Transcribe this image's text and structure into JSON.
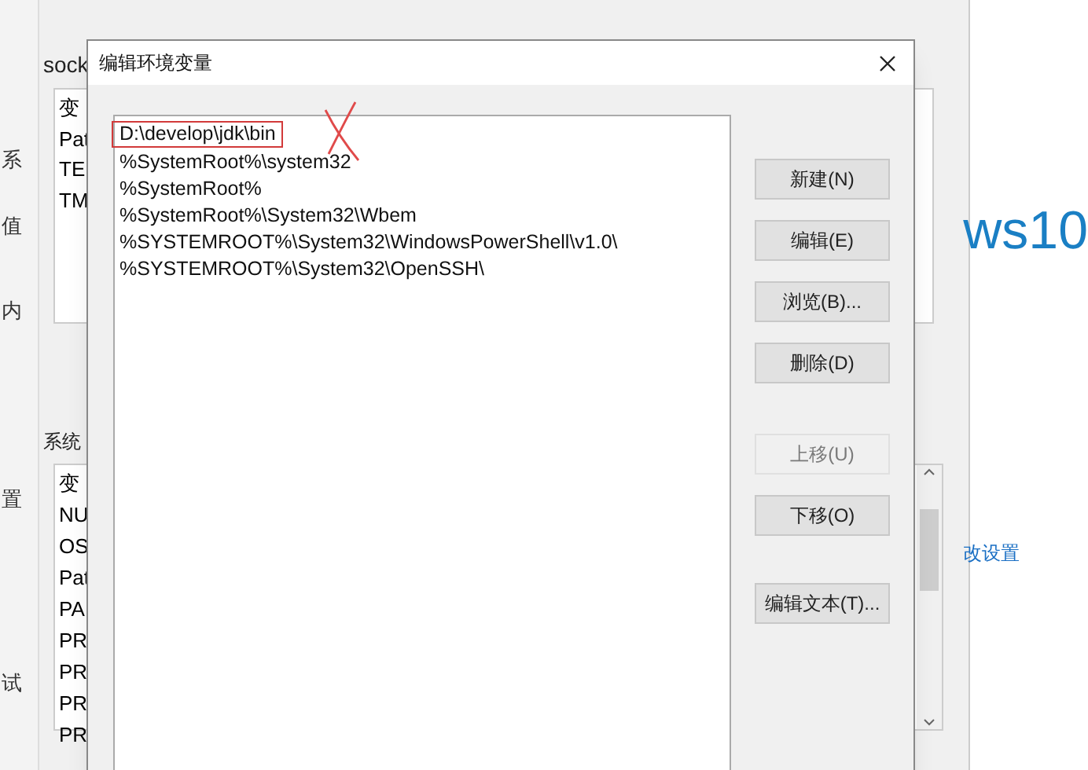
{
  "side_fragments": [
    "系",
    "值",
    "内",
    "置",
    "试"
  ],
  "background_window": {
    "user_label": "sock",
    "user_vars": {
      "column": "变",
      "rows": [
        "Pat",
        "TE",
        "TM"
      ]
    },
    "system_label": "系统",
    "system_vars": {
      "column": "变",
      "rows": [
        "NU",
        "OS",
        "Pat",
        "PA",
        "PR",
        "PR",
        "PR",
        "PR"
      ]
    }
  },
  "web_page": {
    "heading_fragment": "ws10",
    "link_fragment": "改设置"
  },
  "dialog": {
    "title": "编辑环境变量",
    "paths": [
      {
        "text": "D:\\develop\\jdk\\bin",
        "marked": true
      },
      {
        "text": "%SystemRoot%\\system32",
        "marked": false
      },
      {
        "text": "%SystemRoot%",
        "marked": false
      },
      {
        "text": "%SystemRoot%\\System32\\Wbem",
        "marked": false
      },
      {
        "text": "%SYSTEMROOT%\\System32\\WindowsPowerShell\\v1.0\\",
        "marked": false
      },
      {
        "text": "%SYSTEMROOT%\\System32\\OpenSSH\\",
        "marked": false
      }
    ],
    "buttons": [
      {
        "label": "新建(N)",
        "disabled": false
      },
      {
        "label": "编辑(E)",
        "disabled": false
      },
      {
        "label": "浏览(B)...",
        "disabled": false
      },
      {
        "label": "删除(D)",
        "disabled": false
      },
      {
        "label": "上移(U)",
        "disabled": true
      },
      {
        "label": "下移(O)",
        "disabled": false
      },
      {
        "label": "编辑文本(T)...",
        "disabled": false
      }
    ]
  }
}
